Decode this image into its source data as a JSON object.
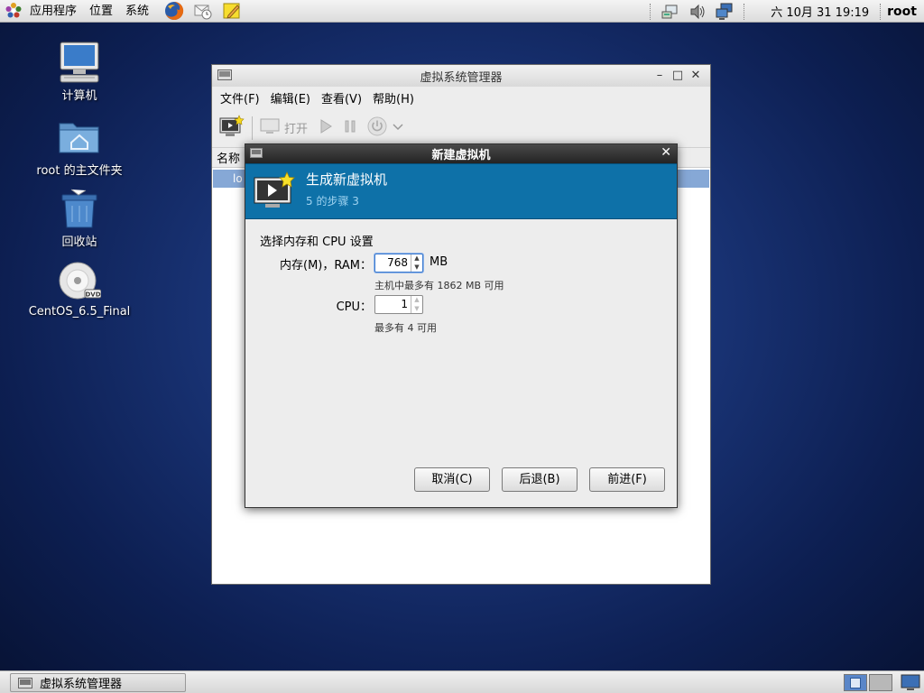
{
  "top_panel": {
    "menus": [
      "应用程序",
      "位置",
      "系统"
    ],
    "launchers": [
      "firefox-icon",
      "mail-clock-icon",
      "note-icon"
    ],
    "tray_icons": [
      "network-printer-icon",
      "volume-icon",
      "network-icon"
    ],
    "clock": "六 10月 31 19:19",
    "user": "root"
  },
  "desktop": {
    "icons": [
      {
        "label": "计算机",
        "icon": "computer-icon"
      },
      {
        "label": "root 的主文件夹",
        "icon": "home-folder-icon"
      },
      {
        "label": "回收站",
        "icon": "trash-icon"
      },
      {
        "label": "CentOS_6.5_Final",
        "icon": "dvd-icon"
      }
    ]
  },
  "main_window": {
    "title": "虚拟系统管理器",
    "controls": [
      "–",
      "□",
      "✕"
    ],
    "menus": [
      "文件(F)",
      "编辑(E)",
      "查看(V)",
      "帮助(H)"
    ],
    "toolbar": {
      "open_label": "打开"
    },
    "list_header": "名称",
    "row_label": "lo"
  },
  "dialog": {
    "title": "新建虚拟机",
    "close": "✕",
    "header_title": "生成新虚拟机",
    "header_subtitle": "5 的步骤 3",
    "section_title": "选择内存和 CPU 设置",
    "memory": {
      "label": "内存(M)，RAM：",
      "value": "768",
      "unit": "MB",
      "hint": "主机中最多有 1862 MB 可用"
    },
    "cpu": {
      "label": "CPU：",
      "value": "1",
      "hint": "最多有 4 可用"
    },
    "buttons": {
      "cancel": "取消(C)",
      "back": "后退(B)",
      "forward": "前进(F)"
    }
  },
  "taskbar": {
    "task_label": "虚拟系统管理器"
  },
  "colors": {
    "dialog_header": "#0e71a8",
    "selection": "#86a8d6"
  }
}
